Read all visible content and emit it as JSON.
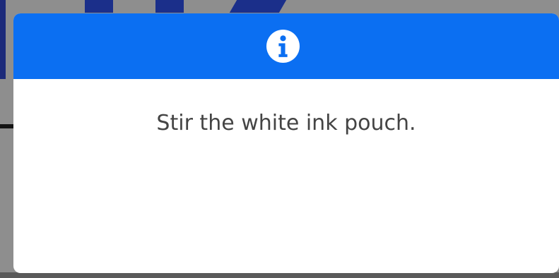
{
  "dialog": {
    "icon": "info-icon",
    "message": "Stir the white ink pouch.",
    "header_color": "#0b6ff2"
  }
}
